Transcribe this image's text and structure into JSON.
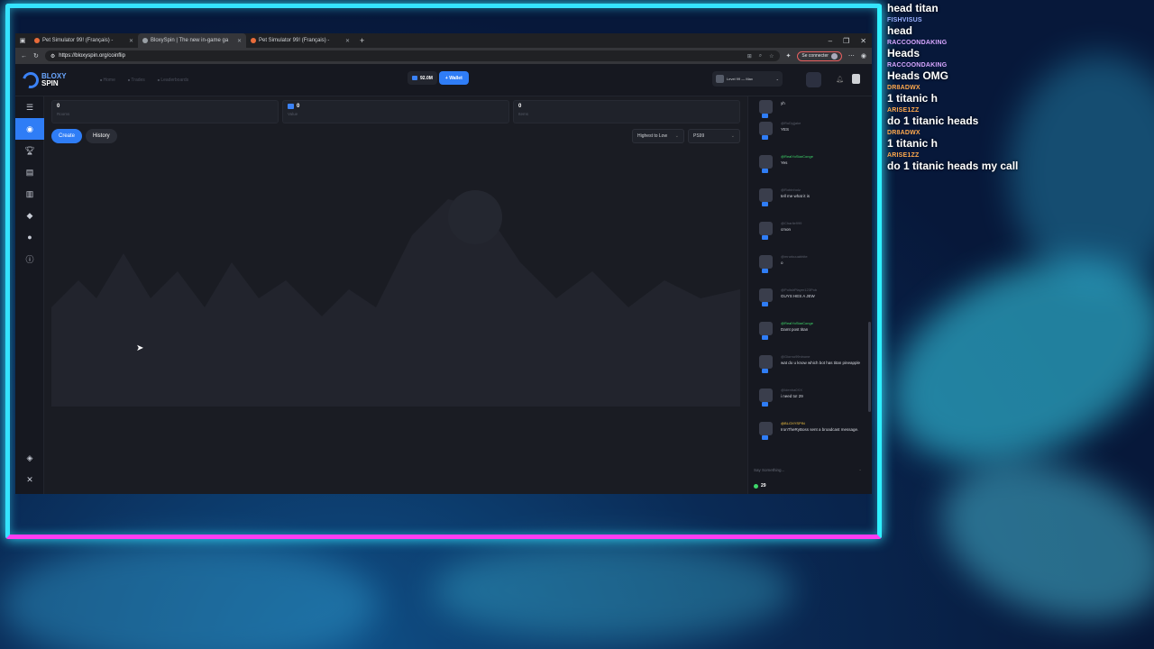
{
  "browser": {
    "tabs": [
      {
        "title": "Pet Simulator 99! (Français) -",
        "active": false
      },
      {
        "title": "BloxySpin | The new in-game ga",
        "active": true
      },
      {
        "title": "Pet Simulator 99! (Français) -",
        "active": false
      }
    ],
    "url": "https://bloxyspin.org/coinflip",
    "connect_label": "Se connecter"
  },
  "site": {
    "logo_top": "BLOXY",
    "logo_bottom": "SPIN",
    "nav": [
      "Home",
      "Trades",
      "Leaderboards"
    ],
    "balance": "92.0M",
    "wallet_label": "Wallet",
    "level_label": "Level 99 — Max",
    "stats": [
      {
        "value": "0",
        "label": "Rooms"
      },
      {
        "value": "0",
        "label": "Value"
      },
      {
        "value": "0",
        "label": "Items"
      }
    ],
    "create_label": "Create",
    "history_label": "History",
    "sort_label": "Highest to Low",
    "game_label": "PS99"
  },
  "chat": {
    "messages": [
      {
        "name": "",
        "text": "yh",
        "color": "gray"
      },
      {
        "name": "@RuDyjjake",
        "text": "YES",
        "color": "gray"
      },
      {
        "name": "@RealYoStarConge",
        "text": "Yes",
        "color": "green"
      },
      {
        "name": "@Robinholz",
        "text": "tell me what it is",
        "color": "gray"
      },
      {
        "name": "@Charlie999",
        "text": "cmon",
        "color": "gray"
      },
      {
        "name": "@mrurkuuabhite",
        "text": "o",
        "color": "gray"
      },
      {
        "name": "@PolishPlayer123Pob",
        "text": "GUYS HES A JEW",
        "color": "gray"
      },
      {
        "name": "@RealYoStarConge",
        "text": "Damt post titan",
        "color": "green"
      },
      {
        "name": "@Giorno99ninone",
        "text": "wat do u know which bot has titan pineapple",
        "color": "gray"
      },
      {
        "name": "@Idenha0XX",
        "text": "i need to! 29",
        "color": "gray"
      },
      {
        "name": "@BLOXYSPIN",
        "text": "IronTheRyBoss sent a broadcast message.",
        "color": "gold"
      }
    ],
    "input_placeholder": "Say Something...",
    "online_count": "29"
  },
  "stream_chat": [
    {
      "name": "FISHVISUS",
      "text": "head titan",
      "color": "#9ab0ff"
    },
    {
      "name": "FISHVISUS",
      "text": "head",
      "color": "#9ab0ff"
    },
    {
      "name": "RACCOONDAKING",
      "text": "Heads",
      "color": "#d7a6ff"
    },
    {
      "name": "RACCOONDAKING",
      "text": "Heads OMG",
      "color": "#d7a6ff"
    },
    {
      "name": "DR8ADWX",
      "text": "1 titanic h",
      "color": "#ffa94d"
    },
    {
      "name": "ARISE1ZZ",
      "text": "do 1 titanic heads",
      "color": "#ffa94d"
    },
    {
      "name": "DR8ADWX",
      "text": "1 titanic h",
      "color": "#ffa94d"
    },
    {
      "name": "ARISE1ZZ",
      "text": "do 1 titanic heads my call",
      "color": "#ffa94d"
    }
  ]
}
